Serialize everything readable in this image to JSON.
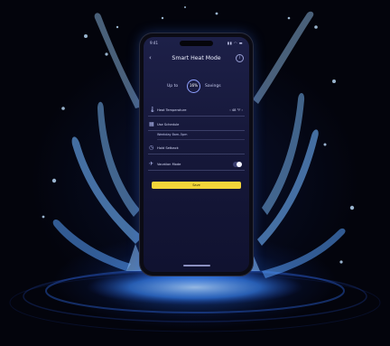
{
  "status_bar": {
    "time": "9:41",
    "signal": "▮▮ ◠ ▬"
  },
  "header": {
    "title": "Smart Heat Mode",
    "back_icon": "chevron-left-icon",
    "info_icon": "info-icon"
  },
  "saving": {
    "prefix": "Up to",
    "value": "16%",
    "suffix": "Savings"
  },
  "settings": [
    {
      "icon": "thermometer-icon",
      "label": "Heat Temperature",
      "value": "‹  48 °F  ›"
    },
    {
      "icon": "calendar-icon",
      "label": "Use Schedule",
      "value": ""
    },
    {
      "icon": "clock-icon",
      "label": "Hold Setback",
      "value": ""
    },
    {
      "icon": "airplane-icon",
      "label": "Vacation Mode",
      "toggle": true
    }
  ],
  "sub_settings": [
    {
      "label": "Weekday 8am–5pm"
    }
  ],
  "save_button": {
    "label": "Save"
  },
  "colors": {
    "accent": "#f2d43a",
    "screen_bg": "#1d2048",
    "water": "#3c8cff"
  }
}
